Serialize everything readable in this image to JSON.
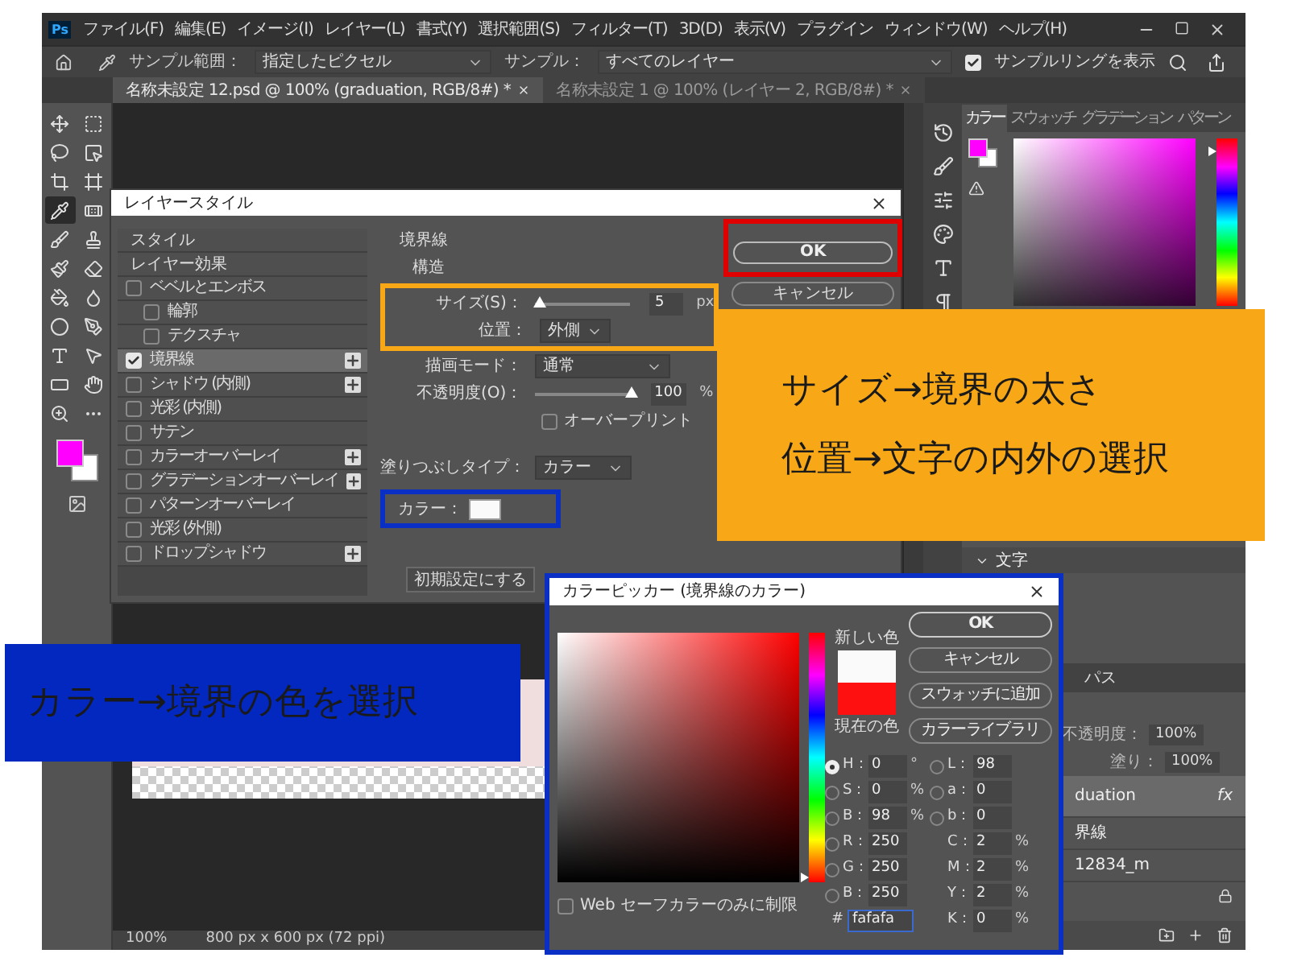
{
  "app": {
    "logo": "Ps",
    "menus": [
      "ファイル(F)",
      "編集(E)",
      "イメージ(I)",
      "レイヤー(L)",
      "書式(Y)",
      "選択範囲(S)",
      "フィルター(T)",
      "3D(D)",
      "表示(V)",
      "プラグイン",
      "ウィンドウ(W)",
      "ヘルプ(H)"
    ],
    "options": {
      "sample_size": {
        "label": "サンプル範囲：",
        "value": "指定したピクセル"
      },
      "sample": {
        "label": "サンプル：",
        "value": "すべてのレイヤー"
      },
      "show_ring": {
        "label": "サンプルリングを表示",
        "checked": true
      }
    },
    "documents": [
      {
        "title": "名称未設定 12.psd @ 100% (graduation, RGB/8#) *",
        "selected": true
      },
      {
        "title": "名称未設定 1 @ 100% (レイヤー 2, RGB/8#) *",
        "selected": false
      }
    ],
    "tools": [
      {
        "kind": "move",
        "selected": false
      },
      {
        "kind": "marquee",
        "selected": false
      },
      {
        "kind": "lasso",
        "selected": false
      },
      {
        "kind": "object-select",
        "selected": false
      },
      {
        "kind": "crop",
        "selected": false
      },
      {
        "kind": "frame",
        "selected": false
      },
      {
        "kind": "eyedropper",
        "selected": true
      },
      {
        "kind": "healing",
        "selected": false
      },
      {
        "kind": "brush",
        "selected": false
      },
      {
        "kind": "stamp",
        "selected": false
      },
      {
        "kind": "history-brush",
        "selected": false
      },
      {
        "kind": "eraser",
        "selected": false
      },
      {
        "kind": "bucket",
        "selected": false
      },
      {
        "kind": "smudge",
        "selected": false
      },
      {
        "kind": "dodge",
        "selected": false
      },
      {
        "kind": "pen",
        "selected": false
      },
      {
        "kind": "type",
        "selected": false
      },
      {
        "kind": "path-select",
        "selected": false
      },
      {
        "kind": "rectangle",
        "selected": false
      },
      {
        "kind": "hand",
        "selected": false
      },
      {
        "kind": "zoom",
        "selected": false
      },
      {
        "kind": "more",
        "selected": false
      }
    ],
    "status": {
      "zoom": "100%",
      "size": "800 px x 600 px (72 ppi)"
    },
    "color_panel": {
      "tabs": [
        {
          "label": "カラー",
          "selected": true
        },
        {
          "label": "スウォッチ",
          "selected": false
        },
        {
          "label": "グラデーション",
          "selected": false
        },
        {
          "label": "パターン",
          "selected": false
        }
      ],
      "hue": {
        "level": 0.95
      }
    },
    "text_panel": {
      "title": "文字"
    },
    "layers_panel": {
      "tab": "パス",
      "opacity": {
        "label": "不透明度：",
        "value": "100%"
      },
      "fill": {
        "label": "塗り：",
        "value": "100%"
      },
      "layers": [
        {
          "name": "duation",
          "selected": true,
          "badge": "fx"
        },
        {
          "name": "界線",
          "selected": false
        },
        {
          "name": "12834_m",
          "selected": false
        }
      ]
    }
  },
  "layer_style": {
    "title": "レイヤースタイル",
    "styles": [
      {
        "kind": "header",
        "label": "スタイル",
        "selected": false
      },
      {
        "kind": "header",
        "label": "レイヤー効果",
        "selected": false
      },
      {
        "kind": "effect",
        "label": "ベベルとエンボス",
        "checked": false,
        "selected": false,
        "add_button": false,
        "children": [
          {
            "kind": "effect",
            "label": "輪郭",
            "checked": false,
            "selected": false,
            "add_button": false
          },
          {
            "kind": "effect",
            "label": "テクスチャ",
            "checked": false,
            "selected": false,
            "add_button": false
          }
        ]
      },
      {
        "kind": "effect",
        "label": "境界線",
        "checked": true,
        "selected": true,
        "add_button": true
      },
      {
        "kind": "effect",
        "label": "シャドウ (内側)",
        "checked": false,
        "selected": false,
        "add_button": true
      },
      {
        "kind": "effect",
        "label": "光彩 (内側)",
        "checked": false,
        "selected": false,
        "add_button": false
      },
      {
        "kind": "effect",
        "label": "サテン",
        "checked": false,
        "selected": false,
        "add_button": false
      },
      {
        "kind": "effect",
        "label": "カラーオーバーレイ",
        "checked": false,
        "selected": false,
        "add_button": true
      },
      {
        "kind": "effect",
        "label": "グラデーションオーバーレイ",
        "checked": false,
        "selected": false,
        "add_button": true
      },
      {
        "kind": "effect",
        "label": "パターンオーバーレイ",
        "checked": false,
        "selected": false,
        "add_button": false
      },
      {
        "kind": "effect",
        "label": "光彩 (外側)",
        "checked": false,
        "selected": false,
        "add_button": false
      },
      {
        "kind": "effect",
        "label": "ドロップシャドウ",
        "checked": false,
        "selected": false,
        "add_button": true
      }
    ],
    "stroke": {
      "group_title": "境界線",
      "section_title": "構造",
      "size": {
        "label": "サイズ(S)：",
        "value": "5",
        "unit": "px",
        "level": 0.05
      },
      "position": {
        "label": "位置：",
        "value": "外側"
      },
      "blend_mode": {
        "label": "描画モード：",
        "value": "通常"
      },
      "opacity": {
        "label": "不透明度(O)：",
        "value": "100",
        "unit": "%",
        "level": 1
      },
      "overprint": {
        "label": "オーバープリント",
        "checked": false
      },
      "fill_type": {
        "label": "塗りつぶしタイプ：",
        "value": "カラー"
      },
      "color": {
        "label": "カラー："
      }
    },
    "buttons": [
      "OK",
      "キャンセル"
    ],
    "reset_button": "初期設定にする"
  },
  "color_picker": {
    "title": "カラーピッカー (境界線のカラー)",
    "new_label": "新しい色",
    "current_label": "現在の色",
    "hue": {
      "level": 0
    },
    "buttons": [
      "OK",
      "キャンセル",
      "スウォッチに追加",
      "カラーライブラリ"
    ],
    "left_fields": [
      {
        "kind": "radio",
        "label": "H：",
        "value": "0",
        "unit": "°",
        "selected": true
      },
      {
        "kind": "radio",
        "label": "S：",
        "value": "0",
        "unit": "%",
        "selected": false
      },
      {
        "kind": "radio",
        "label": "B：",
        "value": "98",
        "unit": "%",
        "selected": false
      },
      {
        "kind": "radio",
        "label": "R：",
        "value": "250",
        "selected": false
      },
      {
        "kind": "radio",
        "label": "G：",
        "value": "250",
        "selected": false
      },
      {
        "kind": "radio",
        "label": "B：",
        "value": "250",
        "selected": false
      },
      {
        "kind": "hex",
        "label": "#",
        "value": "fafafa"
      }
    ],
    "right_fields": [
      {
        "kind": "radio",
        "label": "L：",
        "value": "98",
        "selected": false
      },
      {
        "kind": "radio",
        "label": "a：",
        "value": "0",
        "selected": false
      },
      {
        "kind": "radio",
        "label": "b：",
        "value": "0",
        "selected": false
      },
      {
        "kind": "plain",
        "label": "C：",
        "value": "2",
        "unit": "%"
      },
      {
        "kind": "plain",
        "label": "M：",
        "value": "2",
        "unit": "%"
      },
      {
        "kind": "plain",
        "label": "Y：",
        "value": "2",
        "unit": "%"
      },
      {
        "kind": "plain",
        "label": "K：",
        "value": "0",
        "unit": "%"
      }
    ],
    "web_only": {
      "label": "Web セーフカラーのみに制限",
      "checked": false
    }
  },
  "callouts": [
    {
      "lines": [
        "サイズ→境界の太さ",
        "位置→文字の内外の選択"
      ],
      "color": "#f8a817"
    },
    {
      "lines": [
        "カラー→境界の色を選択"
      ],
      "color": "#0228c0"
    }
  ]
}
